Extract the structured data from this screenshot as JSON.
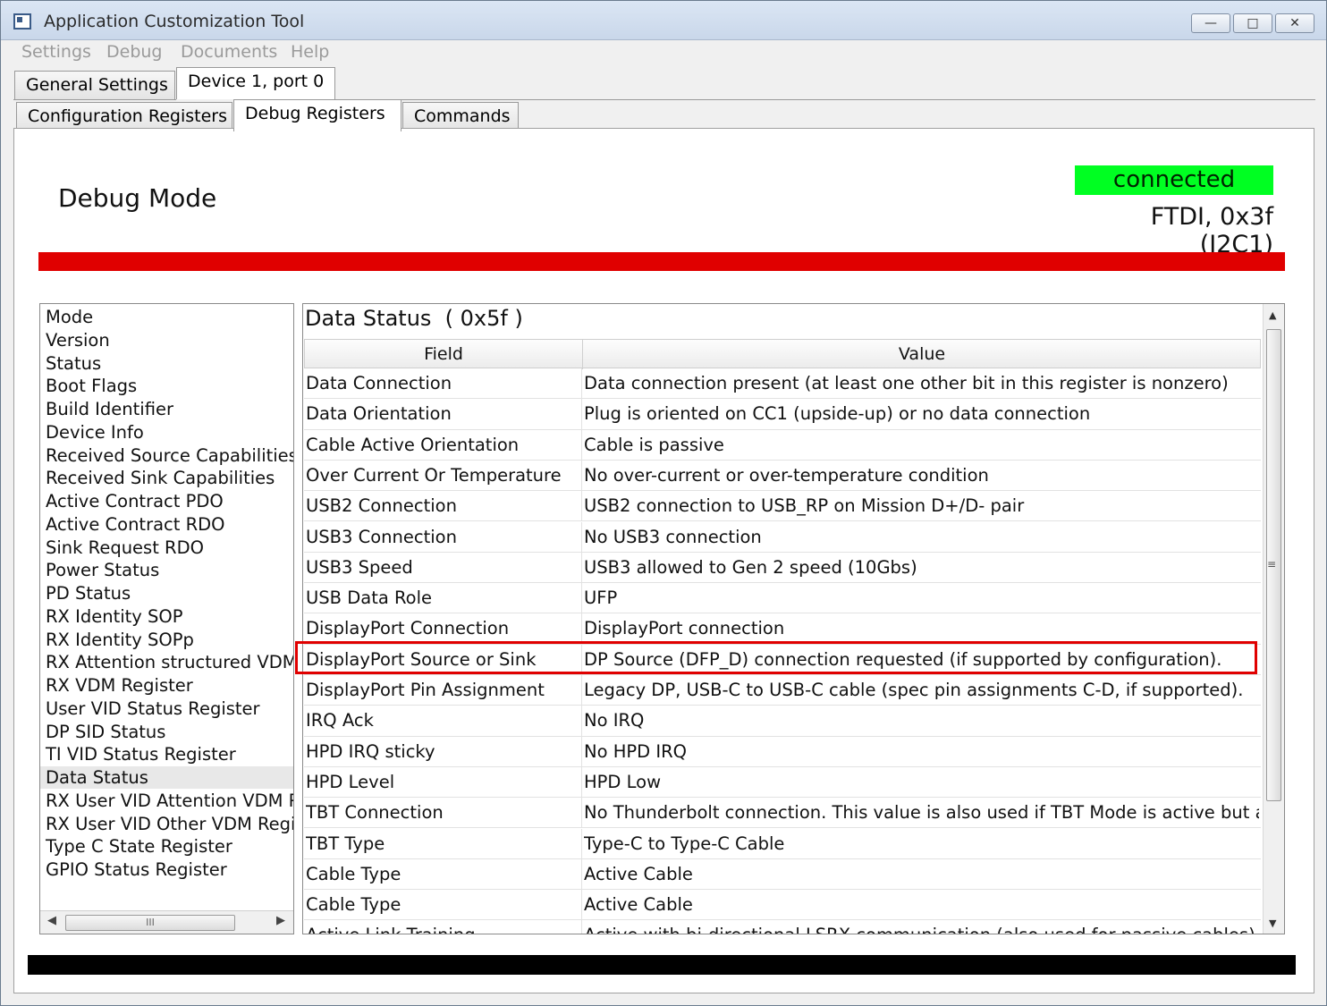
{
  "window": {
    "title": "Application Customization Tool",
    "controls": {
      "minimize": "—",
      "maximize": "□",
      "close": "✕"
    }
  },
  "menu": [
    "Settings",
    "Debug",
    "Documents",
    "Help"
  ],
  "tabs_top": [
    {
      "label": "General Settings",
      "active": false
    },
    {
      "label": "Device 1, port 0",
      "active": true
    }
  ],
  "tabs_sub": [
    {
      "label": "Configuration Registers",
      "active": false
    },
    {
      "label": "Debug Registers",
      "active": true
    },
    {
      "label": "Commands",
      "active": false
    }
  ],
  "header": {
    "mode_title": "Debug Mode",
    "connection_status": "connected",
    "device_address": "FTDI, 0x3f (I2C1)"
  },
  "colors": {
    "status_ok": "#00ff22",
    "alert_bar": "#e00000",
    "bottom_bar": "#000000",
    "highlight": "#e00000"
  },
  "registers": [
    "Mode",
    "Version",
    "Status",
    "Boot Flags",
    "Build Identifier",
    "Device Info",
    "Received Source Capabilities",
    "Received Sink Capabilities",
    "Active Contract PDO",
    "Active Contract RDO",
    "Sink Request RDO",
    "Power Status",
    "PD Status",
    "RX Identity SOP",
    "RX Identity SOPp",
    "RX Attention structured VDM",
    "RX VDM Register",
    "User VID Status Register",
    "DP SID Status",
    "TI VID Status Register",
    "Data Status",
    "RX User VID Attention VDM Re",
    "RX User VID Other VDM Regist",
    "Type C State Register",
    "GPIO Status Register"
  ],
  "selected_register": "Data Status",
  "detail": {
    "title": "Data Status  ( 0x5f )",
    "columns": [
      "Field",
      "Value"
    ],
    "rows": [
      [
        "Data Connection",
        "Data connection present (at least one other bit in this register is nonzero)"
      ],
      [
        "Data Orientation",
        "Plug is oriented on CC1 (upside-up) or no data connection"
      ],
      [
        "Cable Active Orientation",
        "Cable is passive"
      ],
      [
        "Over Current Or Temperature",
        "No over-current or over-temperature condition"
      ],
      [
        "USB2 Connection",
        "USB2 connection to USB_RP on Mission D+/D- pair"
      ],
      [
        "USB3 Connection",
        "No USB3 connection"
      ],
      [
        "USB3 Speed",
        "USB3 allowed to Gen 2 speed (10Gbs)"
      ],
      [
        "USB Data Role",
        "UFP"
      ],
      [
        "DisplayPort Connection",
        "DisplayPort connection"
      ],
      [
        "DisplayPort Source or Sink",
        "DP Source (DFP_D) connection requested (if supported by configuration)."
      ],
      [
        "DisplayPort Pin Assignment",
        "Legacy DP, USB-C to USB-C cable (spec pin assignments C-D, if supported)."
      ],
      [
        "IRQ Ack",
        "No IRQ"
      ],
      [
        "HPD IRQ sticky",
        "No HPD IRQ"
      ],
      [
        "HPD Level",
        "HPD Low"
      ],
      [
        "TBT Connection",
        "No Thunderbolt connection. This value is also used if TBT Mode is active but an Atte"
      ],
      [
        "TBT Type",
        "Type-C to Type-C Cable"
      ],
      [
        "Cable Type",
        "Active Cable"
      ],
      [
        "Cable Type",
        "Active Cable"
      ],
      [
        "Active Link Training",
        "Active with bi-directional LSRX communication (also used for passive cables)"
      ]
    ],
    "highlighted_row": 9
  },
  "scroll_icons": {
    "up": "▲",
    "down": "▼",
    "left": "◀",
    "right": "▶",
    "grip_h": "III",
    "grip_v": "≡"
  }
}
